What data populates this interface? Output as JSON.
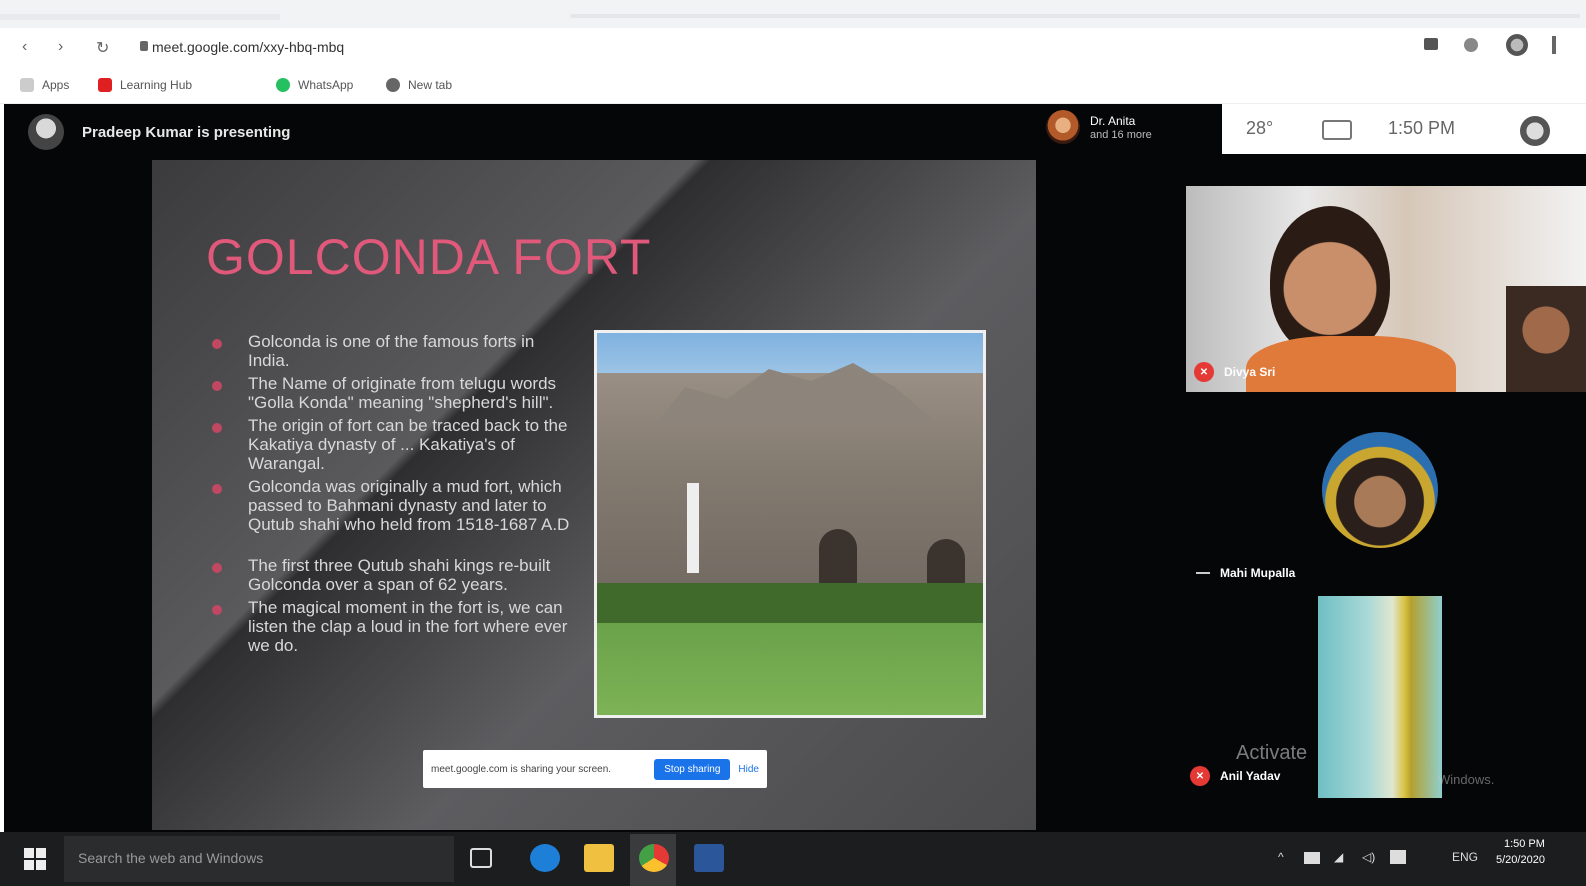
{
  "browser": {
    "url": "meet.google.com/xxy-hbq-mbq",
    "bookmarks": [
      "Apps",
      "Learning Hub",
      "WhatsApp",
      "New tab"
    ]
  },
  "meet": {
    "presenting_text": "Pradeep Kumar is presenting",
    "self_name": "Dr. Anita",
    "self_sub": "and 16 more",
    "share_banner": "meet.google.com is sharing your screen.",
    "stop_sharing": "Stop sharing",
    "hide": "Hide"
  },
  "system_panel": {
    "temp": "28°",
    "time": "1:50 PM"
  },
  "slide": {
    "title": "GOLCONDA FORT",
    "bullets": [
      "Golconda is one of the famous forts in India.",
      "The Name of originate from telugu words \"Golla Konda\" meaning \"shepherd's hill\".",
      "The origin of fort can be traced back to the Kakatiya dynasty of ... Kakatiya's of Warangal.",
      "Golconda was originally a mud fort, which passed to Bahmani dynasty and later to Qutub shahi who held from 1518-1687 A.D",
      "The first three Qutub shahi kings re-built Golconda over a span of 62 years.",
      "The magical moment in the fort is, we can listen the clap a loud in the fort where ever we do."
    ]
  },
  "participants": [
    {
      "name": "Divya Sri",
      "muted": true
    },
    {
      "name": "Mahi Mupalla",
      "muted": false
    },
    {
      "name": "Anil Yadav",
      "muted": true
    }
  ],
  "watermark": {
    "line1": "Activate",
    "line2": "Windows."
  },
  "taskbar": {
    "search_placeholder": "Search the web and Windows",
    "lang": "ENG",
    "time": "1:50 PM",
    "date": "5/20/2020"
  },
  "colors": {
    "slide_title": "#e0587a",
    "bullet": "#c04862",
    "meet_bg": "#050607",
    "stop_button": "#1a73e8"
  }
}
